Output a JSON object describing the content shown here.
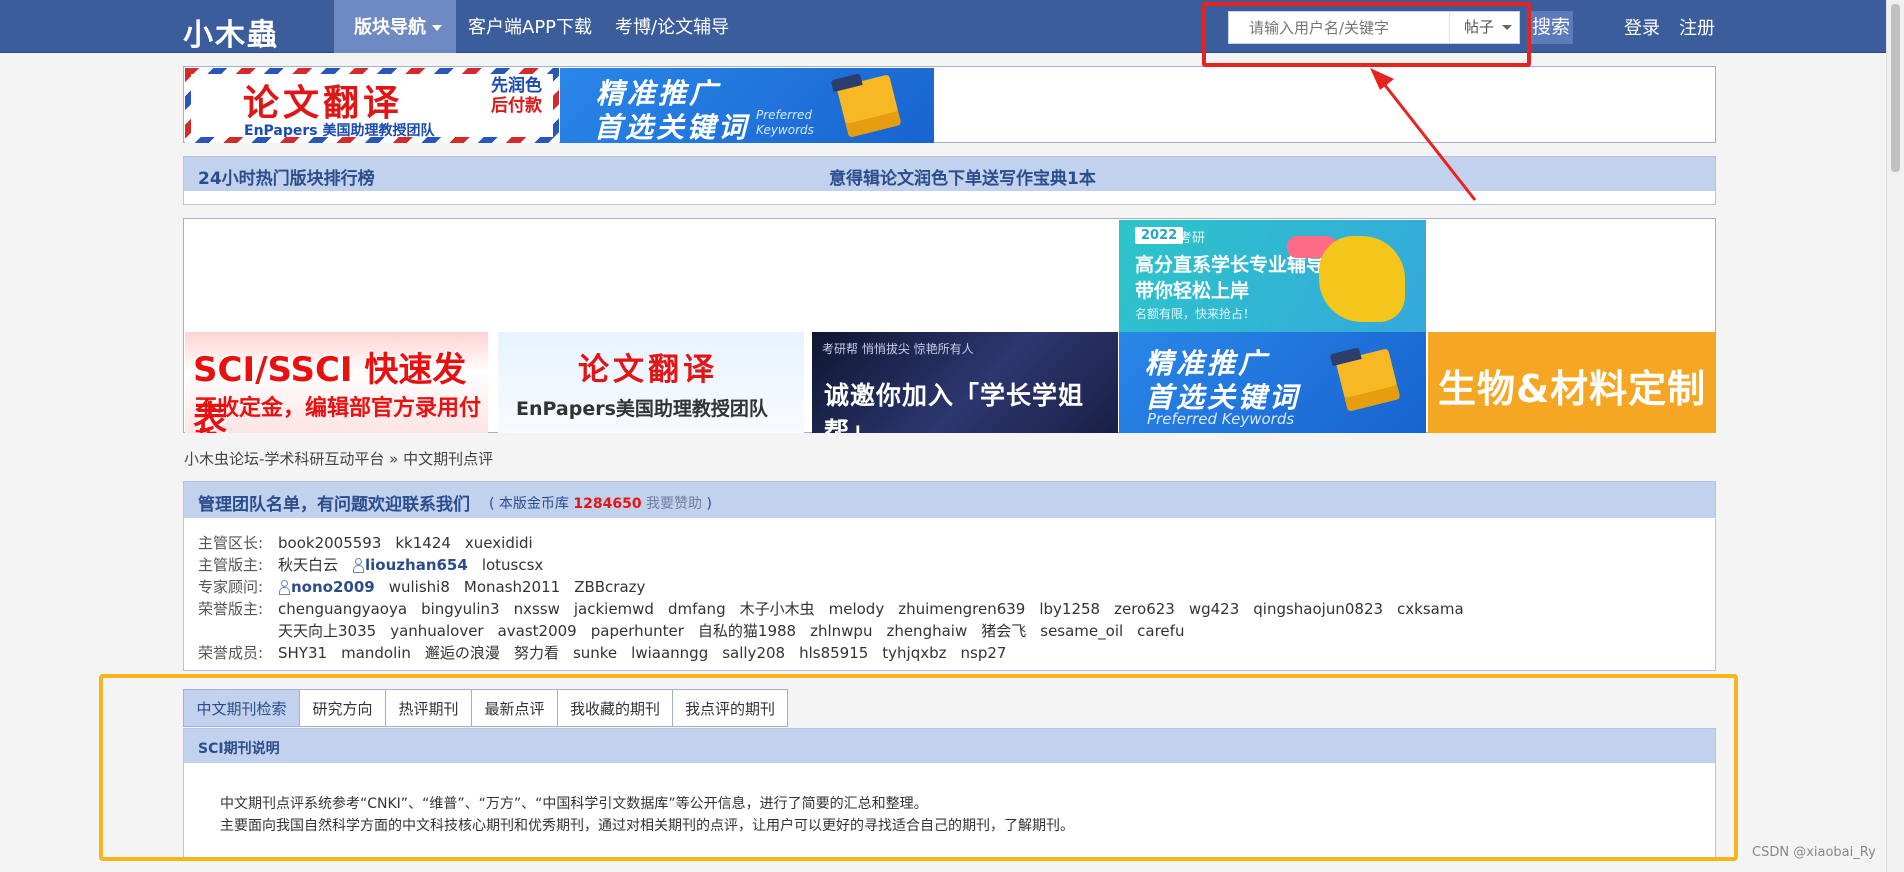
{
  "nav": {
    "logo": "小木蟲",
    "items": [
      "版块导航",
      "客户端APP下载",
      "考博/论文辅导"
    ],
    "search_placeholder": "请输入用户名/关键字",
    "search_type": "帖子",
    "search_button": "搜索",
    "login": "登录",
    "register": "注册"
  },
  "ads": {
    "translate_top": {
      "big": "论文翻译",
      "side1": "先润色",
      "side2": "后付款",
      "sub": "EnPapers  美国助理教授团队"
    },
    "promo": {
      "l1": "精准推广",
      "l2": "首选关键词",
      "tag1": "Preferred",
      "tag2": "Keywords",
      "tag_full": "Preferred  Keywords"
    },
    "kaoyan": {
      "year": "2022",
      "kind": "考研",
      "l1": "高分直系学长专业辅导",
      "l2": "带你轻松上岸",
      "l3": "名额有限，快来抢占！"
    },
    "sci": {
      "l1": "SCI/SSCI 快速发表",
      "l2": "不收定金，编辑部官方录用付款"
    },
    "translate": {
      "l1": "论文翻译",
      "l2": "EnPapers美国助理教授团队"
    },
    "xzxj": {
      "top": "考研帮    悄悄拔尖 惊艳所有人",
      "l1": "诚邀你加入「学长学姐帮」"
    },
    "bio": {
      "l1": "生物&材料定制"
    }
  },
  "hot": {
    "title": "24小时热门版块排行榜",
    "link": "意得辑论文润色下单送写作宝典1本"
  },
  "breadcrumb": "小木虫论坛-学术科研互动平台 » 中文期刊点评",
  "team": {
    "title": "管理团队名单，有问题欢迎联系我们",
    "fund_open": "( 本版金币库 ",
    "fund_value": "1284650",
    "sponsor": " 我要赞助",
    "fund_close": " )",
    "rows": [
      {
        "label": "主管区长:",
        "names": [
          "book2005593",
          "kk1424",
          "xuexididi"
        ]
      },
      {
        "label": "主管版主:",
        "names": [
          "秋天白云",
          "liouzhan654",
          "lotuscsx"
        ]
      },
      {
        "label": "专家顾问:",
        "names": [
          "nono2009",
          "wulishi8",
          "Monash2011",
          "ZBBcrazy"
        ]
      },
      {
        "label": "荣誉版主:",
        "names": [
          "chenguangyaoya",
          "bingyulin3",
          "nxssw",
          "jackiemwd",
          "dmfang",
          "木子小木虫",
          "melody",
          "zhuimengren639",
          "lby1258",
          "zero623",
          "wg423",
          "qingshaojun0823",
          "cxksama"
        ]
      },
      {
        "label": "",
        "names": [
          "天天向上3035",
          "yanhualover",
          "avast2009",
          "paperhunter",
          "自私的猫1988",
          "zhlnwpu",
          "zhenghaiw",
          "猪会飞",
          "sesame_oil",
          "carefu"
        ]
      },
      {
        "label": "荣誉成员:",
        "names": [
          "SHY31",
          "mandolin",
          "邂逅の浪漫",
          "努力看",
          "sunke",
          "lwiaanngg",
          "sally208",
          "hls85915",
          "tyhjqxbz",
          "nsp27"
        ]
      }
    ]
  },
  "tabs": [
    "中文期刊检索",
    "研究方向",
    "热评期刊",
    "最新点评",
    "我收藏的期刊",
    "我点评的期刊"
  ],
  "desc": {
    "title": "SCI期刊说明",
    "l1": "中文期刊点评系统参考“CNKI”、“维普”、“万方”、“中国科学引文数据库”等公开信息，进行了简要的汇总和整理。",
    "l2": "主要面向我国自然科学方面的中文科技核心期刊和优秀期刊，通过对相关期刊的点评，让用户可以更好的寻找适合自己的期刊，了解期刊。"
  },
  "watermark": "CSDN @xiaobai_Ry",
  "colors": {
    "nav": "#3c5d9c",
    "panel_head": "#c2d1ee",
    "highlight_red": "#e8231f",
    "highlight_orange": "#f7b51d"
  }
}
